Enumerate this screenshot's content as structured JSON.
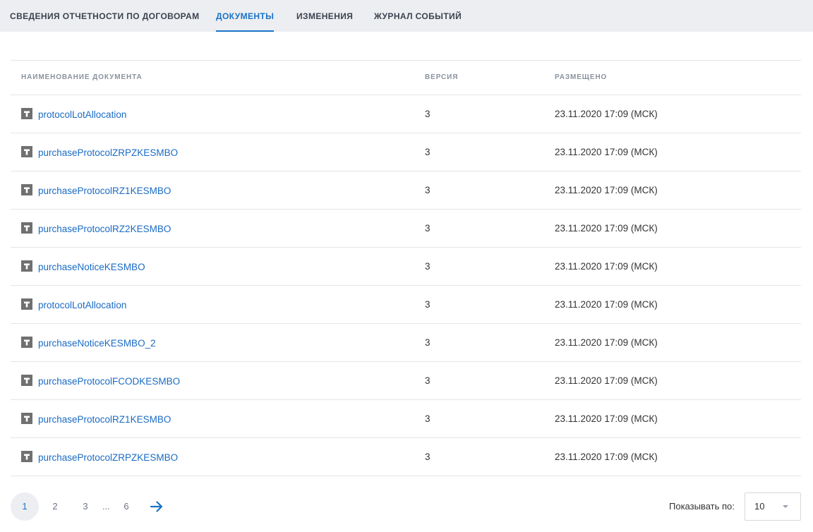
{
  "tabs": [
    {
      "label": "СВЕДЕНИЯ ОТЧЕТНОСТИ ПО ДОГОВОРАМ",
      "active": false
    },
    {
      "label": "ДОКУМЕНТЫ",
      "active": true
    },
    {
      "label": "ИЗМЕНЕНИЯ",
      "active": false
    },
    {
      "label": "ЖУРНАЛ СОБЫТИЙ",
      "active": false
    }
  ],
  "table": {
    "columns": [
      "НАИМЕНОВАНИЕ ДОКУМЕНТА",
      "ВЕРСИЯ",
      "РАЗМЕЩЕНО"
    ],
    "rows": [
      {
        "name": "protocolLotAllocation",
        "version": "3",
        "posted": "23.11.2020 17:09 (МСК)"
      },
      {
        "name": "purchaseProtocolZRPZKESMBO",
        "version": "3",
        "posted": "23.11.2020 17:09 (МСК)"
      },
      {
        "name": "purchaseProtocolRZ1KESMBO",
        "version": "3",
        "posted": "23.11.2020 17:09 (МСК)"
      },
      {
        "name": "purchaseProtocolRZ2KESMBO",
        "version": "3",
        "posted": "23.11.2020 17:09 (МСК)"
      },
      {
        "name": "purchaseNoticeKESMBO",
        "version": "3",
        "posted": "23.11.2020 17:09 (МСК)"
      },
      {
        "name": "protocolLotAllocation",
        "version": "3",
        "posted": "23.11.2020 17:09 (МСК)"
      },
      {
        "name": "purchaseNoticeKESMBO_2",
        "version": "3",
        "posted": "23.11.2020 17:09 (МСК)"
      },
      {
        "name": "purchaseProtocolFCODKESMBO",
        "version": "3",
        "posted": "23.11.2020 17:09 (МСК)"
      },
      {
        "name": "purchaseProtocolRZ1KESMBO",
        "version": "3",
        "posted": "23.11.2020 17:09 (МСК)"
      },
      {
        "name": "purchaseProtocolZRPZKESMBO",
        "version": "3",
        "posted": "23.11.2020 17:09 (МСК)"
      }
    ],
    "row_icon": "text-document-icon"
  },
  "pagination": {
    "pages": [
      "1",
      "2",
      "3",
      "6"
    ],
    "current": "1",
    "ellipsis": "...",
    "next_icon": "arrow-right-icon"
  },
  "per_page": {
    "label": "Показывать по:",
    "value": "10"
  },
  "colors": {
    "accent": "#1a73c8",
    "link": "#1a6bc4",
    "tabbar_bg": "#eceef1",
    "icon_gray": "#707070"
  }
}
